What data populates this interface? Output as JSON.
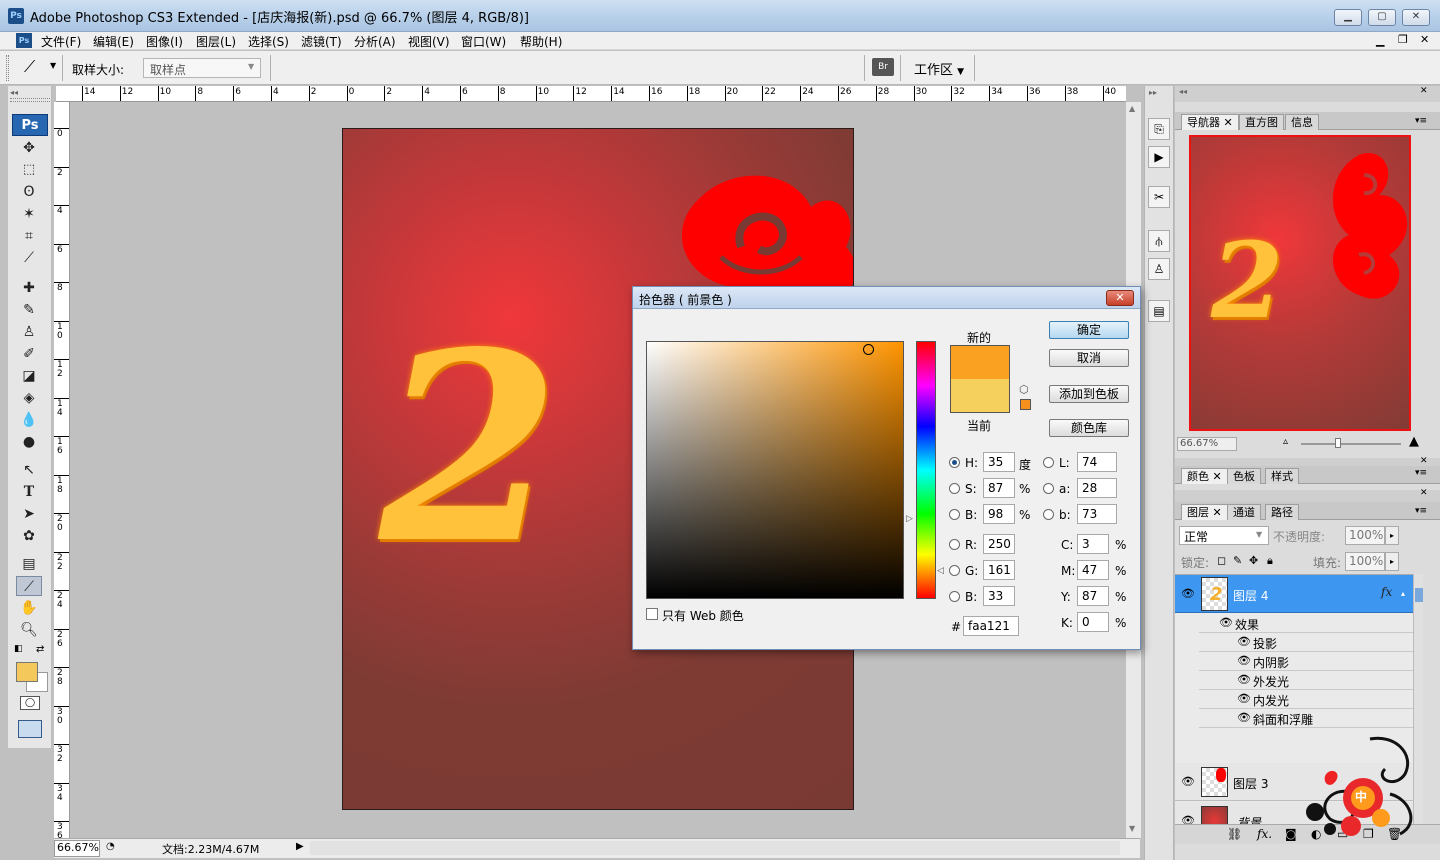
{
  "window": {
    "title": "Adobe Photoshop CS3 Extended - [店庆海报(新).psd @ 66.7% (图层 4, RGB/8)]",
    "app_icon": "Ps",
    "controls": [
      "minimize",
      "maximize",
      "close"
    ]
  },
  "menu": {
    "items": [
      "文件(F)",
      "编辑(E)",
      "图像(I)",
      "图层(L)",
      "选择(S)",
      "滤镜(T)",
      "分析(A)",
      "视图(V)",
      "窗口(W)",
      "帮助(H)"
    ]
  },
  "options": {
    "sample_size_label": "取样大小:",
    "sample_size_value": "取样点",
    "workspace_label": "工作区"
  },
  "toolbox": {
    "logo": "Ps",
    "tools": [
      "move-tool",
      "marquee-tool",
      "lasso-tool",
      "magic-wand-tool",
      "crop-tool",
      "slice-tool",
      "healing-brush-tool",
      "brush-tool",
      "clone-stamp-tool",
      "history-brush-tool",
      "eraser-tool",
      "paint-bucket-tool",
      "blur-tool",
      "dodge-tool",
      "path-selection-tool",
      "type-tool",
      "direct-selection-tool",
      "custom-shape-tool",
      "notes-tool",
      "eyedropper-tool",
      "hand-tool",
      "zoom-tool"
    ],
    "foreground_color": "#f5c85c",
    "background_color": "#ffffff"
  },
  "rulers": {
    "top_labels": [
      "14",
      "12",
      "10",
      "8",
      "6",
      "4",
      "2",
      "0",
      "2",
      "4",
      "6",
      "8",
      "10",
      "12",
      "14",
      "16",
      "18",
      "20",
      "22",
      "24",
      "26",
      "28",
      "30",
      "32",
      "34",
      "36",
      "38",
      "40"
    ],
    "left_labels": [
      "0",
      "2",
      "4",
      "6",
      "8",
      "1 0",
      "1 2",
      "1 4",
      "1 6",
      "1 8",
      "2 0",
      "2 2",
      "2 4",
      "2 6",
      "2 8",
      "3 0",
      "3 2",
      "3 4",
      "3 6"
    ]
  },
  "document": {
    "numeral": "2"
  },
  "status": {
    "zoom": "66.67%",
    "doc_info": "文档:2.23M/4.67M"
  },
  "navigator": {
    "tabs": [
      "导航器",
      "直方图",
      "信息"
    ],
    "zoom": "66.67%"
  },
  "swatches_panel": {
    "tabs": [
      "颜色",
      "色板",
      "样式"
    ]
  },
  "layers_panel": {
    "tabs": [
      "图层",
      "通道",
      "路径"
    ],
    "blend_mode": "正常",
    "opacity_label": "不透明度:",
    "opacity": "100%",
    "lock_label": "锁定:",
    "fill_label": "填充:",
    "fill": "100%",
    "layers": [
      {
        "name": "图层 4",
        "selected": true,
        "fx": "fx"
      },
      {
        "name": "图层 3",
        "selected": false
      },
      {
        "name": "背景",
        "selected": false
      }
    ],
    "effects_label": "效果",
    "effects": [
      "投影",
      "内阴影",
      "外发光",
      "内发光",
      "斜面和浮雕"
    ],
    "watermark_char": "中"
  },
  "color_picker": {
    "title": "拾色器 ( 前景色 )",
    "new_label": "新的",
    "current_label": "当前",
    "new_color": "#faa121",
    "current_color": "#f5d05c",
    "buttons": {
      "ok": "确定",
      "cancel": "取消",
      "add_swatch": "添加到色板",
      "libraries": "颜色库"
    },
    "web_only_label": "只有 Web 颜色",
    "hsb": {
      "H": "35",
      "H_unit": "度",
      "S": "87",
      "S_unit": "%",
      "B": "98",
      "B_unit": "%"
    },
    "rgb": {
      "R": "250",
      "G": "161",
      "B": "33"
    },
    "lab": {
      "L": "74",
      "a": "28",
      "b": "73"
    },
    "cmyk": {
      "C": "3",
      "M": "47",
      "Y": "87",
      "K": "0",
      "unit": "%"
    },
    "hex_label": "#",
    "hex": "faa121",
    "labels": {
      "H": "H:",
      "S": "S:",
      "B": "B:",
      "R": "R:",
      "G": "G:",
      "B2": "B:",
      "L": "L:",
      "a": "a:",
      "b": "b:",
      "C": "C:",
      "M": "M:",
      "Y": "Y:",
      "K": "K:"
    }
  }
}
